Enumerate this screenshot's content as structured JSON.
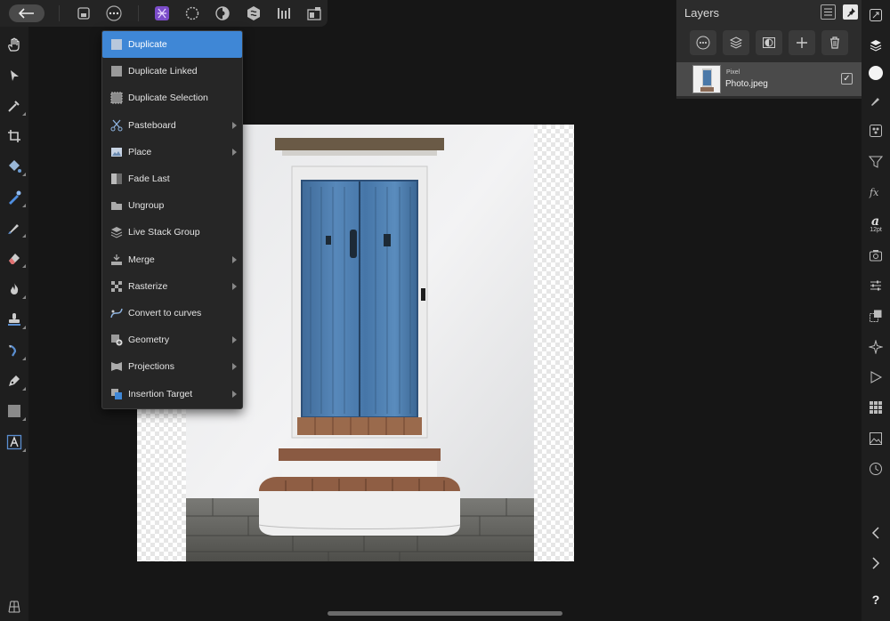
{
  "layers_panel": {
    "title": "Layers",
    "layer": {
      "kind": "Pixel",
      "name": "Photo.jpeg",
      "checked": "✓"
    }
  },
  "context_menu": {
    "items": [
      {
        "label": "Duplicate",
        "selected": true,
        "submenu": false,
        "icon": "duplicate-icon"
      },
      {
        "label": "Duplicate Linked",
        "selected": false,
        "submenu": false,
        "icon": "duplicate-linked-icon"
      },
      {
        "label": "Duplicate Selection",
        "selected": false,
        "submenu": false,
        "icon": "duplicate-selection-icon"
      },
      {
        "label": "Pasteboard",
        "selected": false,
        "submenu": true,
        "icon": "scissors-icon"
      },
      {
        "label": "Place",
        "selected": false,
        "submenu": true,
        "icon": "place-image-icon"
      },
      {
        "label": "Fade Last",
        "selected": false,
        "submenu": false,
        "icon": "fade-last-icon"
      },
      {
        "label": "Ungroup",
        "selected": false,
        "submenu": false,
        "icon": "folder-icon"
      },
      {
        "label": "Live Stack Group",
        "selected": false,
        "submenu": false,
        "icon": "stack-icon"
      },
      {
        "label": "Merge",
        "selected": false,
        "submenu": true,
        "icon": "merge-icon"
      },
      {
        "label": "Rasterize",
        "selected": false,
        "submenu": true,
        "icon": "rasterize-icon"
      },
      {
        "label": "Convert to curves",
        "selected": false,
        "submenu": false,
        "icon": "curves-icon"
      },
      {
        "label": "Geometry",
        "selected": false,
        "submenu": true,
        "icon": "geometry-icon"
      },
      {
        "label": "Projections",
        "selected": false,
        "submenu": true,
        "icon": "projections-icon"
      },
      {
        "label": "Insertion Target",
        "selected": false,
        "submenu": true,
        "icon": "insertion-target-icon"
      }
    ]
  },
  "right_bar": {
    "font_size_label": "12pt",
    "help_label": "?"
  },
  "colors": {
    "menu_highlight": "#3f87d6",
    "persona_accent": "#7b4cc9",
    "door_blue": "#4a78a8"
  }
}
